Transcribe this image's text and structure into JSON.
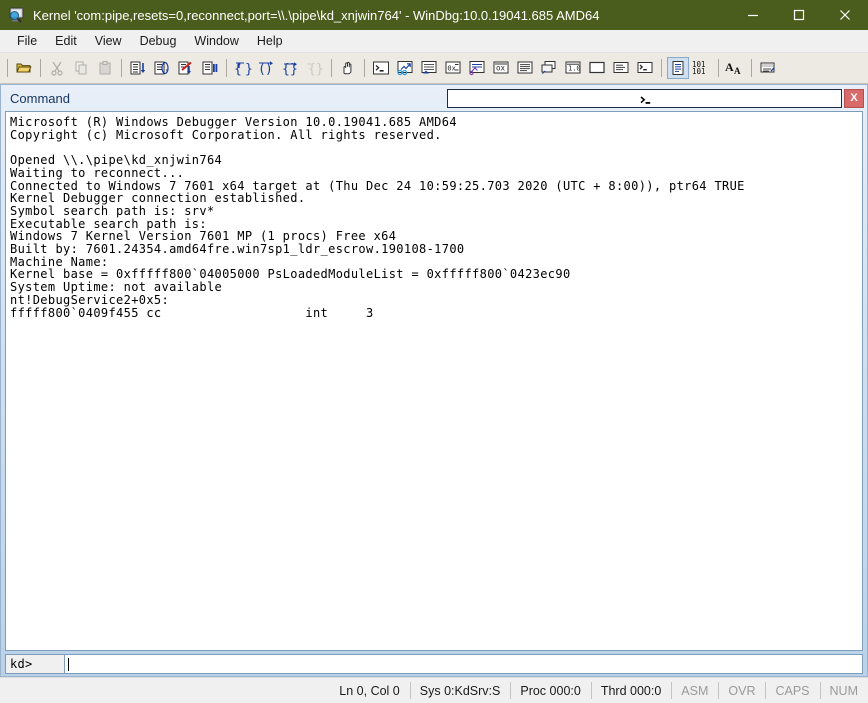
{
  "window": {
    "title": "Kernel 'com:pipe,resets=0,reconnect,port=\\\\.\\pipe\\kd_xnjwin764' - WinDbg:10.0.19041.685 AMD64",
    "icon": "debugger-monitor-icon",
    "minimize_label": "minimize-icon",
    "maximize_label": "maximize-icon",
    "close_label": "close-icon",
    "titlebar_color": "#4a5d1c"
  },
  "menu": {
    "items": [
      {
        "label": "File"
      },
      {
        "label": "Edit"
      },
      {
        "label": "View"
      },
      {
        "label": "Debug"
      },
      {
        "label": "Window"
      },
      {
        "label": "Help"
      }
    ]
  },
  "toolbar": {
    "groups": [
      {
        "items": [
          {
            "icon": "open-folder-icon"
          }
        ]
      },
      {
        "items": [
          {
            "icon": "cut-icon"
          },
          {
            "icon": "copy-icon"
          },
          {
            "icon": "paste-icon"
          }
        ]
      },
      {
        "items": [
          {
            "icon": "step-into-icon"
          },
          {
            "icon": "step-over-icon"
          },
          {
            "icon": "stop-debugging-icon"
          },
          {
            "icon": "break-icon"
          }
        ]
      },
      {
        "items": [
          {
            "icon": "trace-into-braces-icon"
          },
          {
            "icon": "step-out-braces-icon"
          },
          {
            "icon": "run-to-cursor-braces-icon"
          },
          {
            "icon": "braces-disabled-icon"
          }
        ]
      },
      {
        "items": [
          {
            "icon": "hand-break-icon"
          }
        ]
      },
      {
        "items": [
          {
            "icon": "command-window-icon"
          },
          {
            "icon": "watch-window-icon"
          },
          {
            "icon": "locals-window-icon"
          },
          {
            "icon": "registers-window-icon"
          }
        ]
      },
      {
        "items": [
          {
            "icon": "memory-window-icon"
          },
          {
            "icon": "calls-window-icon"
          },
          {
            "icon": "disassembly-window-icon"
          },
          {
            "icon": "scratch-pad-icon"
          },
          {
            "icon": "processes-threads-icon"
          },
          {
            "icon": "blank-window-icon"
          },
          {
            "icon": "notepad-window-icon"
          },
          {
            "icon": "shell-window-icon"
          }
        ]
      },
      {
        "items": [
          {
            "icon": "source-mode-icon",
            "selected": true
          },
          {
            "icon": "binary-mode-icon"
          }
        ]
      },
      {
        "items": [
          {
            "icon": "font-icon"
          }
        ]
      },
      {
        "items": [
          {
            "icon": "options-icon"
          }
        ]
      }
    ]
  },
  "command_window": {
    "title": "Command",
    "console_button": "console-prompt-icon",
    "close_button": "X",
    "console_text": "Microsoft (R) Windows Debugger Version 10.0.19041.685 AMD64\nCopyright (c) Microsoft Corporation. All rights reserved.\n\nOpened \\\\.\\pipe\\kd_xnjwin764\nWaiting to reconnect...\nConnected to Windows 7 7601 x64 target at (Thu Dec 24 10:59:25.703 2020 (UTC + 8:00)), ptr64 TRUE\nKernel Debugger connection established.\nSymbol search path is: srv*\nExecutable search path is:\nWindows 7 Kernel Version 7601 MP (1 procs) Free x64\nBuilt by: 7601.24354.amd64fre.win7sp1_ldr_escrow.190108-1700\nMachine Name:\nKernel base = 0xfffff800`04005000 PsLoadedModuleList = 0xfffff800`0423ec90\nSystem Uptime: not available\nnt!DebugService2+0x5:\nfffff800`0409f455 cc                   int     3",
    "prompt_label": "kd>",
    "prompt_value": "",
    "prompt_placeholder": ""
  },
  "status_bar": {
    "cells": [
      {
        "label": "Ln 0, Col 0",
        "dim": false
      },
      {
        "label": "Sys 0:KdSrv:S",
        "dim": false
      },
      {
        "label": "Proc 000:0",
        "dim": false
      },
      {
        "label": "Thrd 000:0",
        "dim": false
      },
      {
        "label": "ASM",
        "dim": true
      },
      {
        "label": "OVR",
        "dim": true
      },
      {
        "label": "CAPS",
        "dim": true
      },
      {
        "label": "NUM",
        "dim": true
      }
    ]
  }
}
